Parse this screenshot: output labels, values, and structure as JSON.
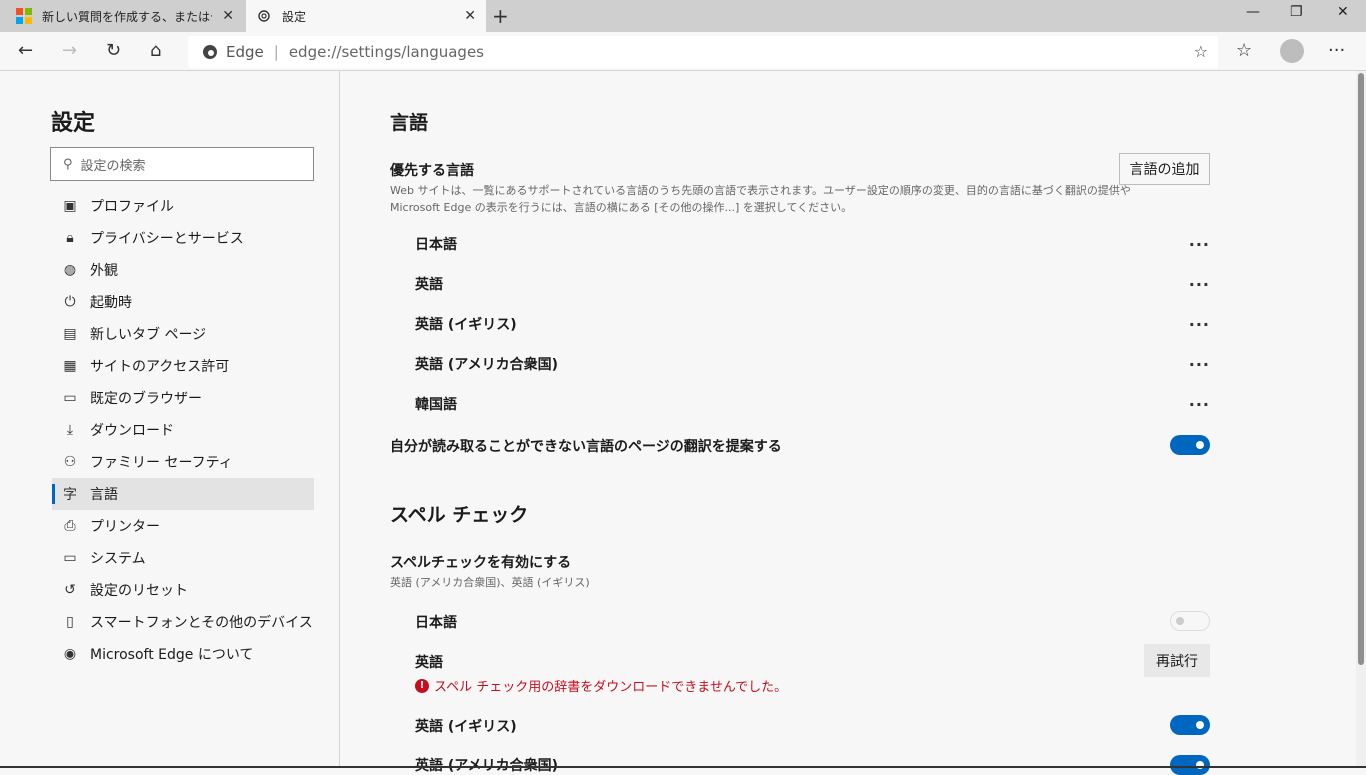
{
  "tabs": [
    {
      "title": "新しい質問を作成する、またはディスカ",
      "icon": "microsoft-logo"
    },
    {
      "title": "設定",
      "icon": "gear-icon"
    }
  ],
  "address": {
    "site": "Edge",
    "url": "edge://settings/languages"
  },
  "sidebar": {
    "title": "設定",
    "search_placeholder": "設定の検索",
    "items": [
      {
        "label": "プロファイル",
        "icon": "profile-icon"
      },
      {
        "label": "プライバシーとサービス",
        "icon": "lock-icon"
      },
      {
        "label": "外観",
        "icon": "palette-icon"
      },
      {
        "label": "起動時",
        "icon": "power-icon"
      },
      {
        "label": "新しいタブ ページ",
        "icon": "newtab-icon"
      },
      {
        "label": "サイトのアクセス許可",
        "icon": "site-permissions-icon"
      },
      {
        "label": "既定のブラウザー",
        "icon": "browser-icon"
      },
      {
        "label": "ダウンロード",
        "icon": "download-icon"
      },
      {
        "label": "ファミリー セーフティ",
        "icon": "family-icon"
      },
      {
        "label": "言語",
        "icon": "language-icon"
      },
      {
        "label": "プリンター",
        "icon": "printer-icon"
      },
      {
        "label": "システム",
        "icon": "laptop-icon"
      },
      {
        "label": "設定のリセット",
        "icon": "reset-icon"
      },
      {
        "label": "スマートフォンとその他のデバイス",
        "icon": "phone-icon"
      },
      {
        "label": "Microsoft Edge について",
        "icon": "edge-icon"
      }
    ]
  },
  "languages_section": {
    "title": "言語",
    "preferred_heading": "優先する言語",
    "preferred_desc_1": "Web サイトは、一覧にあるサポートされている言語のうち先頭の言語で表示されます。ユーザー設定の順序の変更、目的の言語に基づく翻訳の提供や",
    "preferred_desc_2": "Microsoft Edge の表示を行うには、言語の横にある [その他の操作...] を選択してください。",
    "add_button": "言語の追加",
    "languages": [
      "日本語",
      "英語",
      "英語 (イギリス)",
      "英語 (アメリカ合衆国)",
      "韓国語"
    ],
    "more_label": "···",
    "translate_offer": "自分が読み取ることができない言語のページの翻訳を提案する",
    "translate_on": true
  },
  "spell_section": {
    "title": "スペル チェック",
    "enable_heading": "スペルチェックを有効にする",
    "enable_sub": "英語 (アメリカ合衆国)、英語 (イギリス)",
    "rows": [
      {
        "label": "日本語",
        "state": "disabled"
      },
      {
        "label": "英語",
        "retry": "再試行",
        "error": "スペル チェック用の辞書をダウンロードできませんでした。"
      },
      {
        "label": "英語 (イギリス)",
        "state": "on"
      },
      {
        "label": "英語 (アメリカ合衆国)",
        "state": "on"
      }
    ]
  },
  "colors": {
    "accent": "#0067c0",
    "error": "#c50f1f"
  }
}
